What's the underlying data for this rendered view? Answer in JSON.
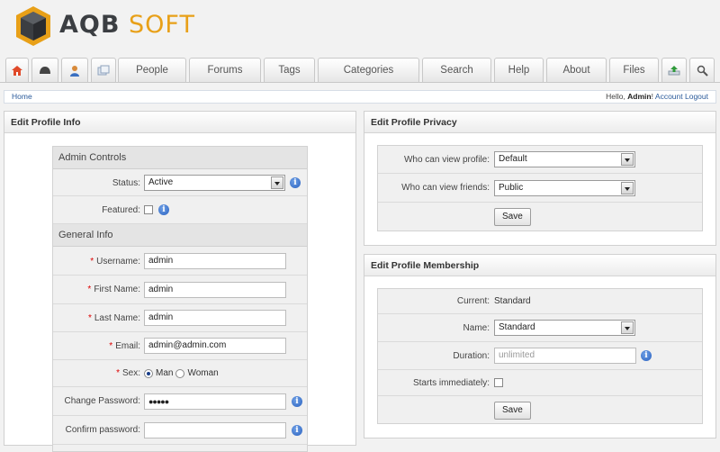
{
  "brand": {
    "part1": "AQB",
    "part2": "SOFT"
  },
  "nav": {
    "icons": [
      {
        "name": "home-icon"
      },
      {
        "name": "helmet-icon"
      },
      {
        "name": "user-icon"
      },
      {
        "name": "windows-icon"
      }
    ],
    "tabs": [
      "People",
      "Forums",
      "Tags",
      "Categories",
      "Search",
      "Help",
      "About",
      "Files"
    ],
    "right_icons": [
      {
        "name": "upload-icon"
      },
      {
        "name": "search-icon"
      }
    ]
  },
  "breadcrumb": {
    "home": "Home"
  },
  "user": {
    "hello": "Hello, ",
    "name": "Admin",
    "exclaim": "!",
    "account": "Account",
    "logout": "Logout"
  },
  "left_panel": {
    "title": "Edit Profile Info",
    "admin_controls": {
      "title": "Admin Controls",
      "status_label": "Status:",
      "status_value": "Active",
      "featured_label": "Featured:"
    },
    "general_info": {
      "title": "General Info",
      "username_label": "Username:",
      "username_value": "admin",
      "first_name_label": "First Name:",
      "first_name_value": "admin",
      "last_name_label": "Last Name:",
      "last_name_value": "admin",
      "email_label": "Email:",
      "email_value": "admin@admin.com",
      "sex_label": "Sex:",
      "sex_options": [
        "Man",
        "Woman"
      ],
      "sex_selected": "Man",
      "change_password_label": "Change Password:",
      "change_password_value": "●●●●●",
      "confirm_password_label": "Confirm password:",
      "confirm_password_value": ""
    },
    "required_mark": "*"
  },
  "privacy_panel": {
    "title": "Edit Profile Privacy",
    "view_profile_label": "Who can view profile:",
    "view_profile_value": "Default",
    "view_friends_label": "Who can view friends:",
    "view_friends_value": "Public",
    "save_label": "Save"
  },
  "membership_panel": {
    "title": "Edit Profile Membership",
    "current_label": "Current:",
    "current_value": "Standard",
    "name_label": "Name:",
    "name_value": "Standard",
    "duration_label": "Duration:",
    "duration_placeholder": "unlimited",
    "starts_label": "Starts immediately:",
    "save_label": "Save"
  },
  "colors": {
    "accent": "#e8a018",
    "link": "#2a5a9a",
    "required": "#dd0000",
    "info": "#2a62c0"
  }
}
